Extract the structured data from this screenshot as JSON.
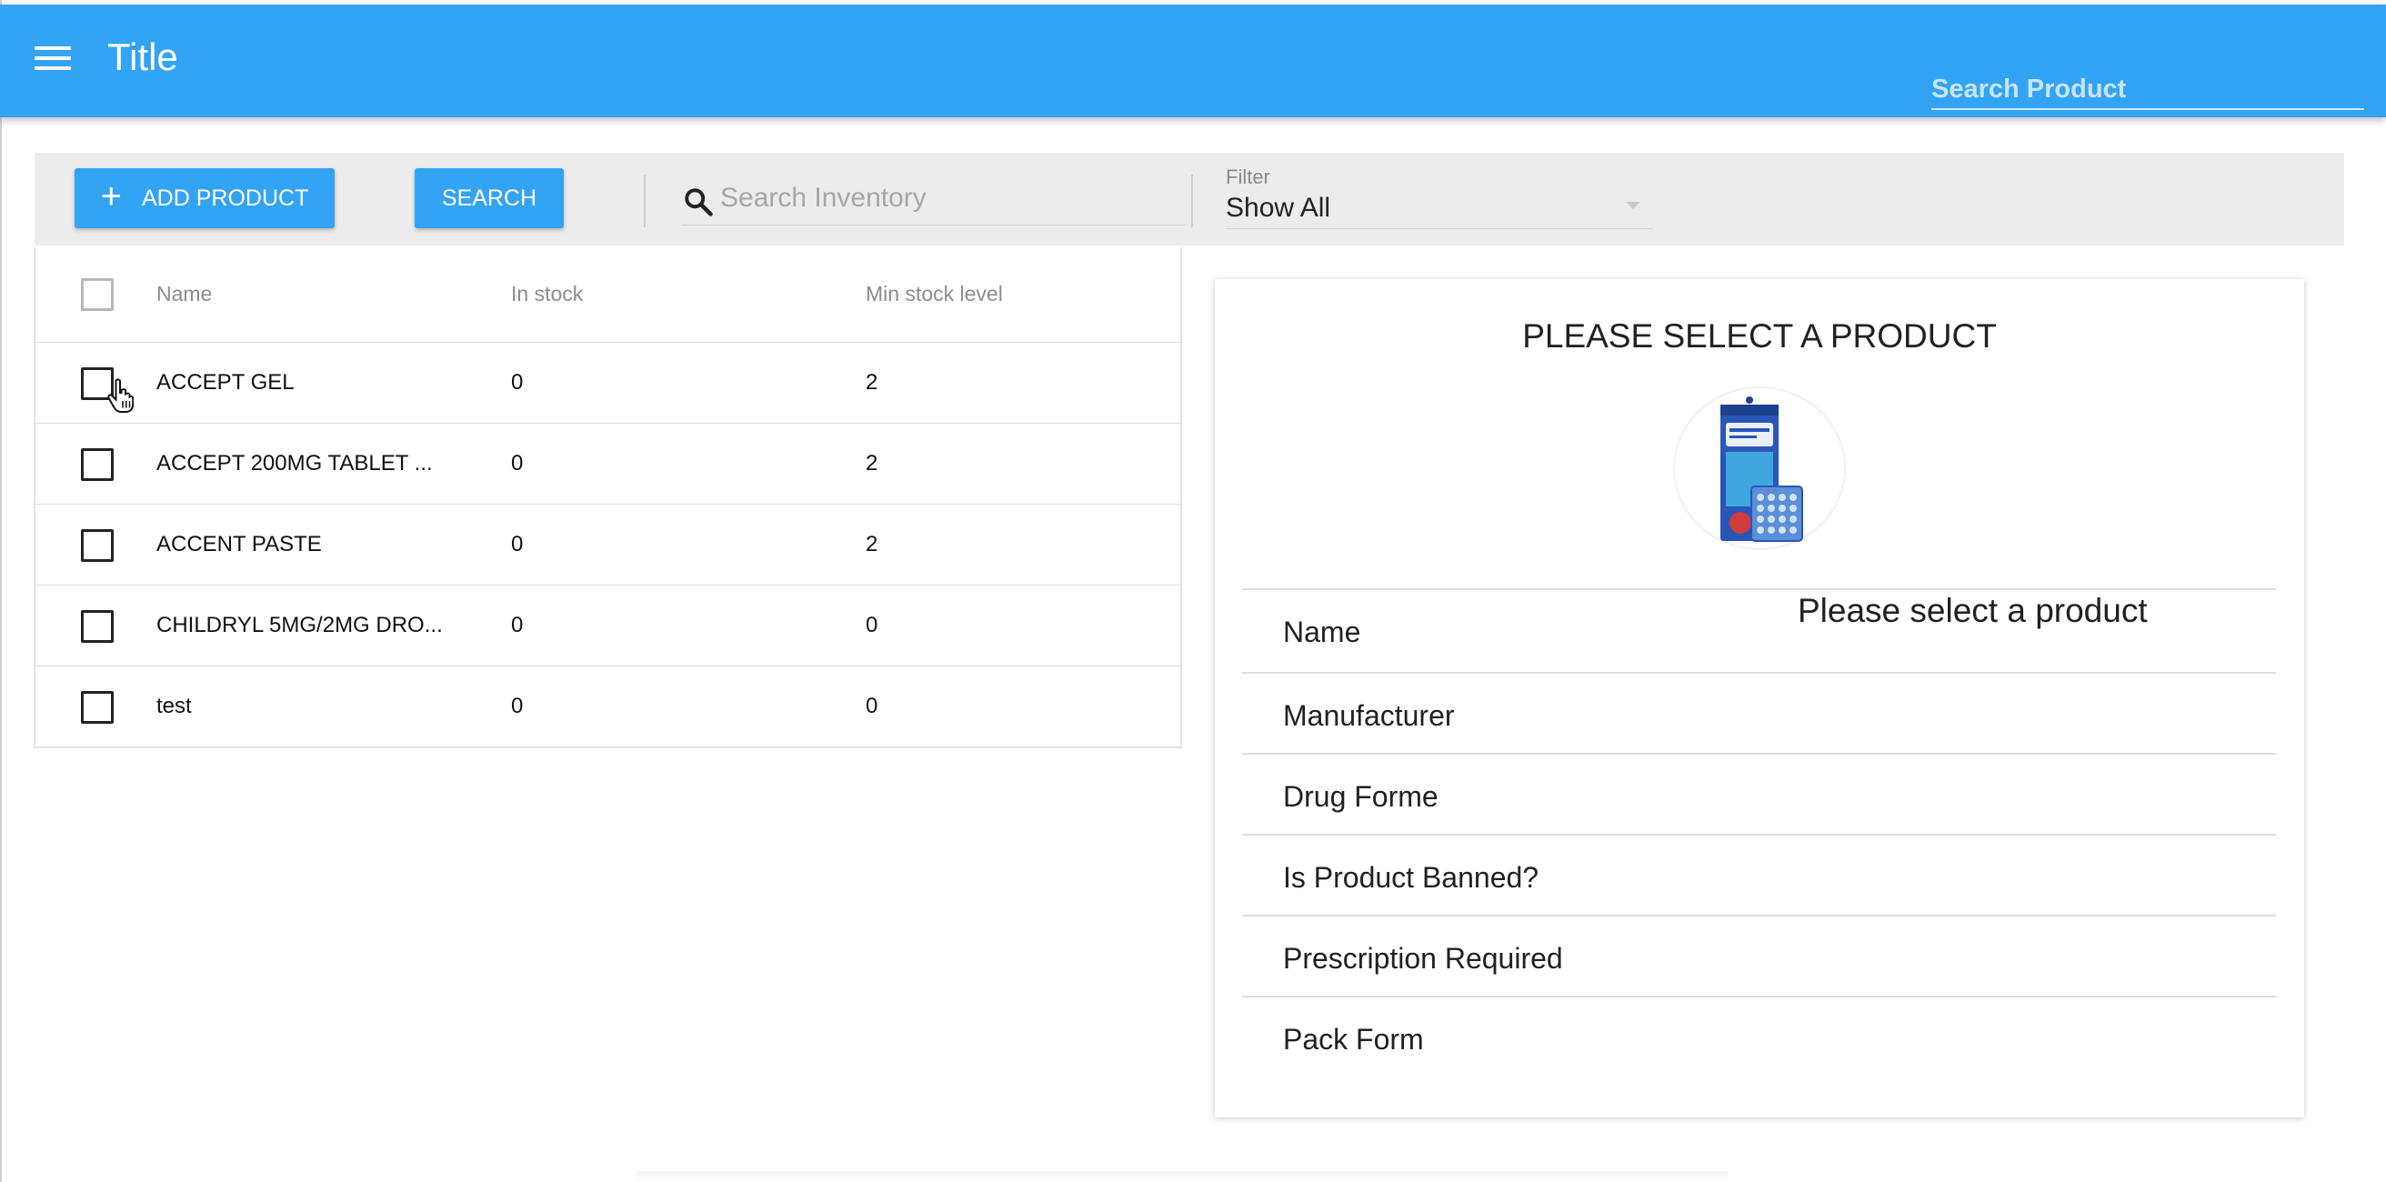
{
  "app_bar": {
    "menu_icon": "hamburger-menu-icon",
    "title": "Title",
    "search_placeholder": "Search Product",
    "color": "#33a3f4"
  },
  "toolbar": {
    "add_label": "ADD PRODUCT",
    "add_icon": "plus-icon",
    "search_label": "SEARCH",
    "inventory_search_placeholder": "Search Inventory",
    "inventory_search_icon": "search-icon",
    "filter_label": "Filter",
    "filter_value": "Show All"
  },
  "table": {
    "columns": [
      "Name",
      "In stock",
      "Min stock level"
    ],
    "rows": [
      {
        "name": "ACCEPT GEL",
        "in_stock": "0",
        "min_stock": "2"
      },
      {
        "name": "ACCEPT 200MG TABLET ...",
        "in_stock": "0",
        "min_stock": "2"
      },
      {
        "name": "ACCENT PASTE",
        "in_stock": "0",
        "min_stock": "2"
      },
      {
        "name": "CHILDRYL 5MG/2MG DRO...",
        "in_stock": "0",
        "min_stock": "0"
      },
      {
        "name": "test",
        "in_stock": "0",
        "min_stock": "0"
      }
    ]
  },
  "details": {
    "title": "PLEASE SELECT A PRODUCT",
    "image": "product-box-image",
    "properties": [
      {
        "label": "Name",
        "value": "Please select a product"
      },
      {
        "label": "Manufacturer",
        "value": ""
      },
      {
        "label": "Drug Forme",
        "value": ""
      },
      {
        "label": "Is Product Banned?",
        "value": ""
      },
      {
        "label": "Prescription Required",
        "value": ""
      },
      {
        "label": "Pack Form",
        "value": ""
      }
    ]
  }
}
